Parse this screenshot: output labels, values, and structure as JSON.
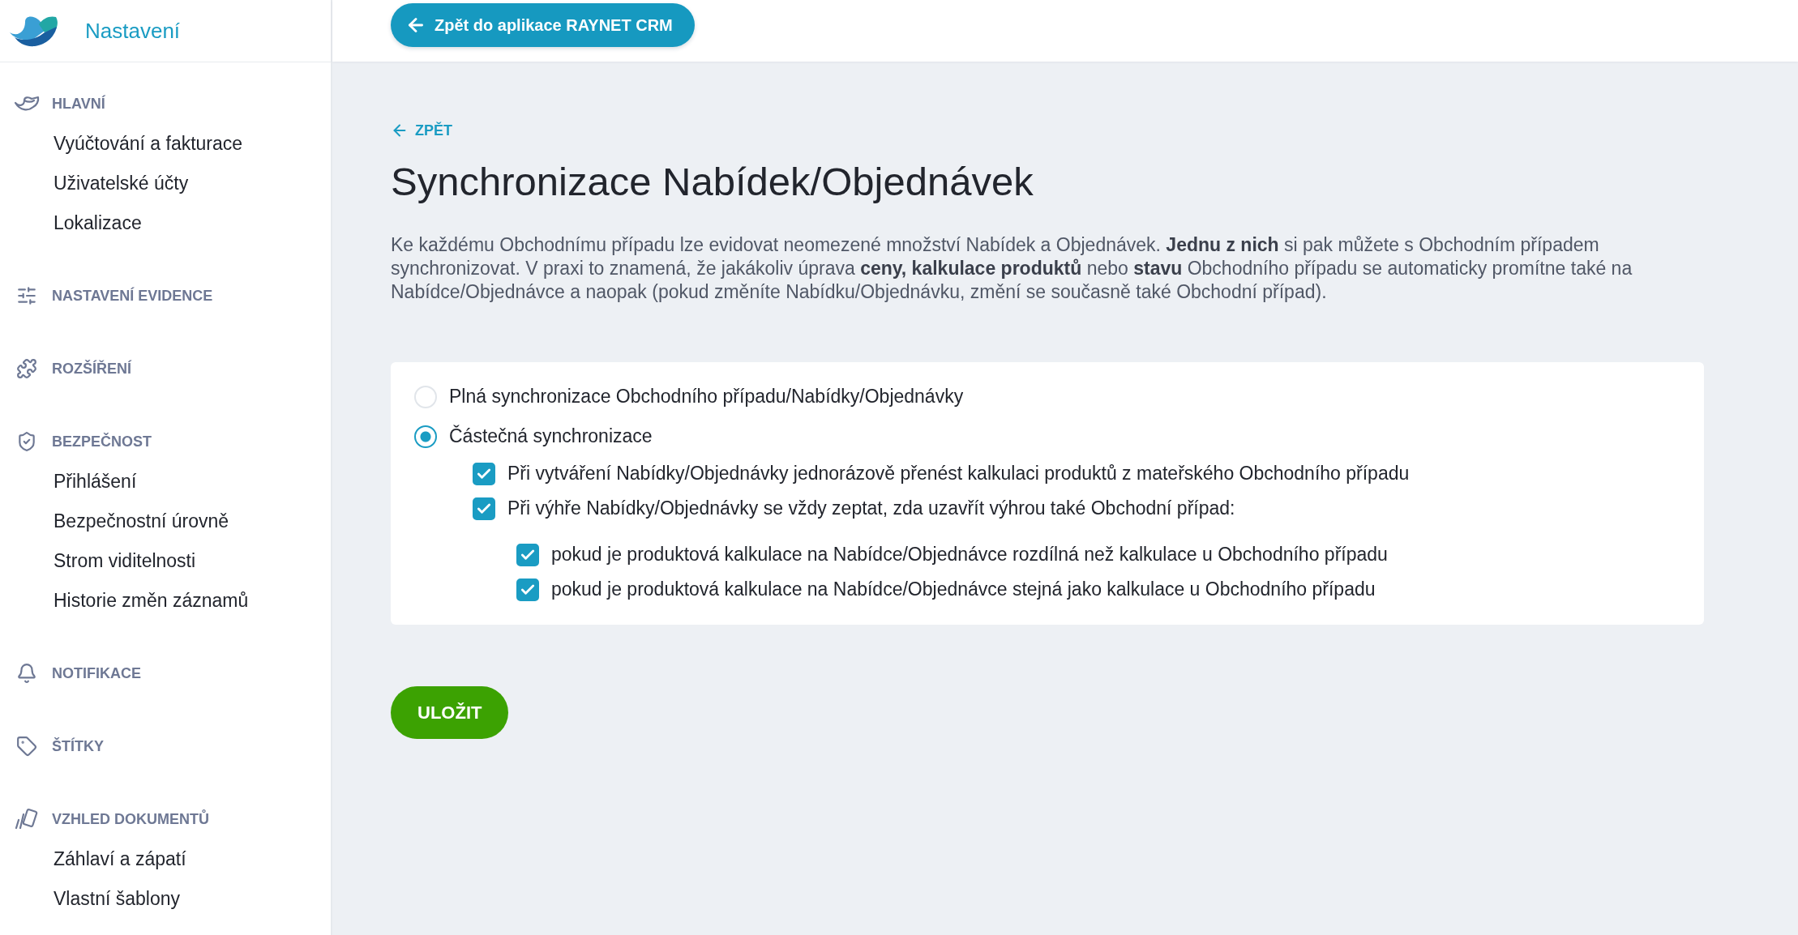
{
  "sidebar": {
    "title": "Nastavení",
    "sections": [
      {
        "label": "HLAVNÍ",
        "items": [
          "Vyúčtování a fakturace",
          "Uživatelské účty",
          "Lokalizace"
        ]
      },
      {
        "label": "NASTAVENÍ EVIDENCE"
      },
      {
        "label": "ROZŠÍŘENÍ"
      },
      {
        "label": "BEZPEČNOST",
        "items": [
          "Přihlášení",
          "Bezpečnostní úrovně",
          "Strom viditelnosti",
          "Historie změn záznamů"
        ]
      },
      {
        "label": "NOTIFIKACE"
      },
      {
        "label": "ŠTÍTKY"
      },
      {
        "label": "VZHLED DOKUMENTŮ",
        "items": [
          "Záhlaví a zápatí",
          "Vlastní šablony"
        ]
      }
    ]
  },
  "top_bar": {
    "back_button": "Zpět do aplikace RAYNET CRM"
  },
  "page": {
    "back_link": "ZPĚT",
    "title": "Synchronizace Nabídek/Objednávek",
    "description": "Ke každému Obchodnímu případu lze evidovat neomezené množství Nabídek a Objednávek. **Jednu z nich** si pak můžete s Obchodním případem synchronizovat. V praxi to znamená, že jakákoliv úprava **ceny, kalkulace produktů** nebo **stavu** Obchodního případu se automaticky promítne také na Nabídce/Objednávce a naopak (pokud změníte Nabídku/Objednávku, změní se současně také Obchodní případ).",
    "sync_options": [
      {
        "kind": "radio",
        "label": "Plná synchronizace Obchodního případu/Nabídky/Objednávky",
        "selected": false
      },
      {
        "kind": "radio",
        "label": "Částečná synchronizace",
        "selected": true,
        "children": [
          {
            "kind": "checkbox",
            "label": "Při vytváření Nabídky/Objednávky jednorázově přenést kalkulaci produktů z mateřského Obchodního případu",
            "checked": true
          },
          {
            "kind": "checkbox",
            "label": "Při výhře Nabídky/Objednávky se vždy zeptat, zda uzavřít výhrou také Obchodní případ:",
            "checked": true,
            "children": [
              {
                "kind": "checkbox",
                "label": "pokud je produktová kalkulace na Nabídce/Objednávce rozdílná než kalkulace u Obchodního případu",
                "checked": true
              },
              {
                "kind": "checkbox",
                "label": "pokud je produktová kalkulace na Nabídce/Objednávce stejná jako kalkulace u Obchodního případu",
                "checked": true
              }
            ]
          }
        ]
      }
    ],
    "save_button": "ULOŽIT"
  }
}
